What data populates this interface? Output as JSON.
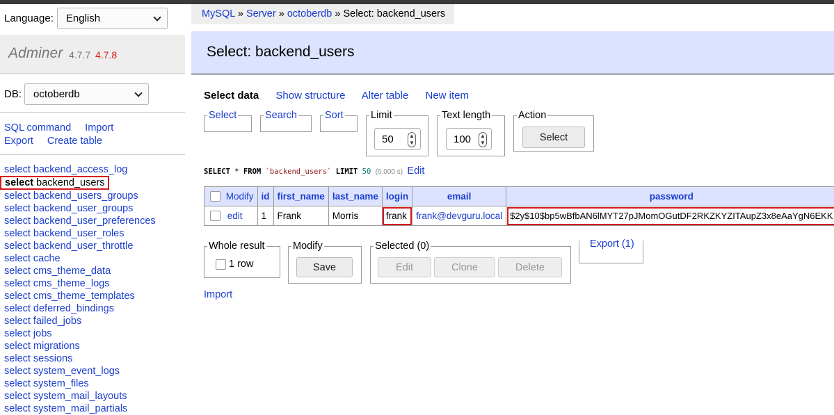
{
  "sidebar": {
    "language_label": "Language:",
    "language_value": "English",
    "app_name": "Adminer",
    "version_current": "4.7.7",
    "version_new": "4.7.8",
    "db_label": "DB:",
    "db_value": "octoberdb",
    "links": [
      "SQL command",
      "Import",
      "Export",
      "Create table"
    ],
    "tables": [
      "select backend_access_log",
      "select backend_users",
      "select backend_users_groups",
      "select backend_user_groups",
      "select backend_user_preferences",
      "select backend_user_roles",
      "select backend_user_throttle",
      "select cache",
      "select cms_theme_data",
      "select cms_theme_logs",
      "select cms_theme_templates",
      "select deferred_bindings",
      "select failed_jobs",
      "select jobs",
      "select migrations",
      "select sessions",
      "select system_event_logs",
      "select system_files",
      "select system_mail_layouts",
      "select system_mail_partials"
    ],
    "active_table": {
      "prefix": "select",
      "name": "backend_users"
    }
  },
  "breadcrumb": {
    "mysql": "MySQL",
    "sep": "»",
    "server": "Server",
    "db": "octoberdb",
    "current": "Select: backend_users"
  },
  "page_title": "Select: backend_users",
  "tabs": [
    "Select data",
    "Show structure",
    "Alter table",
    "New item"
  ],
  "filters": {
    "select": "Select",
    "search": "Search",
    "sort": "Sort",
    "limit_label": "Limit",
    "limit_value": "50",
    "text_length_label": "Text length",
    "text_length_value": "100",
    "action_label": "Action",
    "action_button": "Select"
  },
  "query": {
    "kw1": "SELECT",
    "star": "*",
    "kw2": "FROM",
    "table": "`backend_users`",
    "kw3": "LIMIT",
    "limit": "50",
    "time": "(0.000 s)",
    "edit": "Edit"
  },
  "table": {
    "headers": [
      "Modify",
      "id",
      "first_name",
      "last_name",
      "login",
      "email",
      "password"
    ],
    "row": {
      "edit": "edit",
      "id": "1",
      "first_name": "Frank",
      "last_name": "Morris",
      "login": "frank",
      "email": "frank@devguru.local",
      "password": "$2y$10$bp5wBfbAN6lMYT27pJMomOGutDF2RKZKYZITAupZ3x8eAaYgN6EKK"
    }
  },
  "bottom": {
    "whole_result_label": "Whole result",
    "whole_result_value": "1 row",
    "modify_label": "Modify",
    "save": "Save",
    "selected_label": "Selected (0)",
    "edit": "Edit",
    "clone": "Clone",
    "delete": "Delete",
    "export": "Export (1)",
    "import": "Import"
  }
}
